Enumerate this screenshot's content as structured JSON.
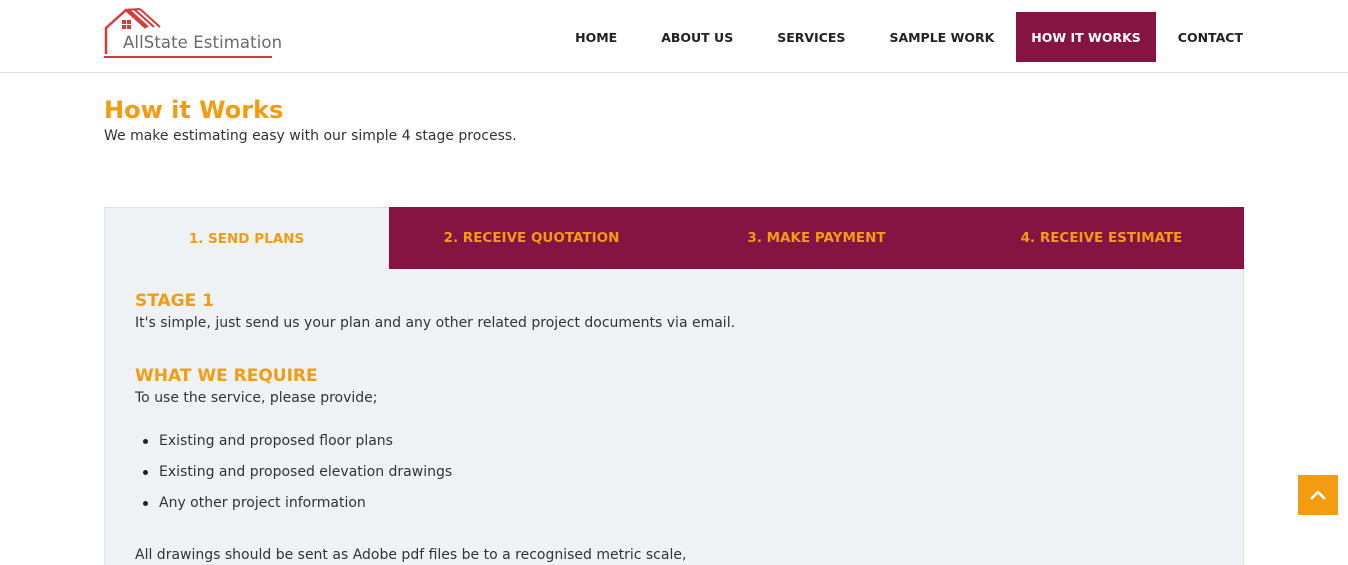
{
  "logo": {
    "text": "AllState Estimation",
    "icon": "house-roof-icon",
    "accent": "#d63a3a"
  },
  "nav": {
    "items": [
      {
        "label": "HOME",
        "active": false
      },
      {
        "label": "ABOUT US",
        "active": false
      },
      {
        "label": "SERVICES",
        "active": false
      },
      {
        "label": "SAMPLE WORK",
        "active": false
      },
      {
        "label": "HOW IT WORKS",
        "active": true
      },
      {
        "label": "CONTACT",
        "active": false
      }
    ],
    "active_color": "#861442"
  },
  "page": {
    "title": "How it Works",
    "subtitle": "We make estimating easy with our simple 4 stage process."
  },
  "tabs": [
    {
      "label": "1. SEND PLANS",
      "active": true
    },
    {
      "label": "2. RECEIVE QUOTATION",
      "active": false
    },
    {
      "label": "3. MAKE PAYMENT",
      "active": false
    },
    {
      "label": "4. RECEIVE ESTIMATE",
      "active": false
    }
  ],
  "panel": {
    "stage_heading": "STAGE 1",
    "stage_text": "It's simple, just send us your plan and any other related project documents via email.",
    "require_heading": "WHAT WE REQUIRE",
    "require_text": "To use the service, please provide;",
    "require_list": [
      "Existing and proposed floor plans",
      "Existing and proposed elevation drawings",
      "Any other project information"
    ],
    "note": "All drawings should be sent as Adobe pdf files be to a recognised metric scale,"
  },
  "back_to_top": {
    "icon": "chevron-up-icon"
  },
  "colors": {
    "accent": "#f39c12",
    "brand": "#861442",
    "panel_bg": "#eef2f5"
  }
}
